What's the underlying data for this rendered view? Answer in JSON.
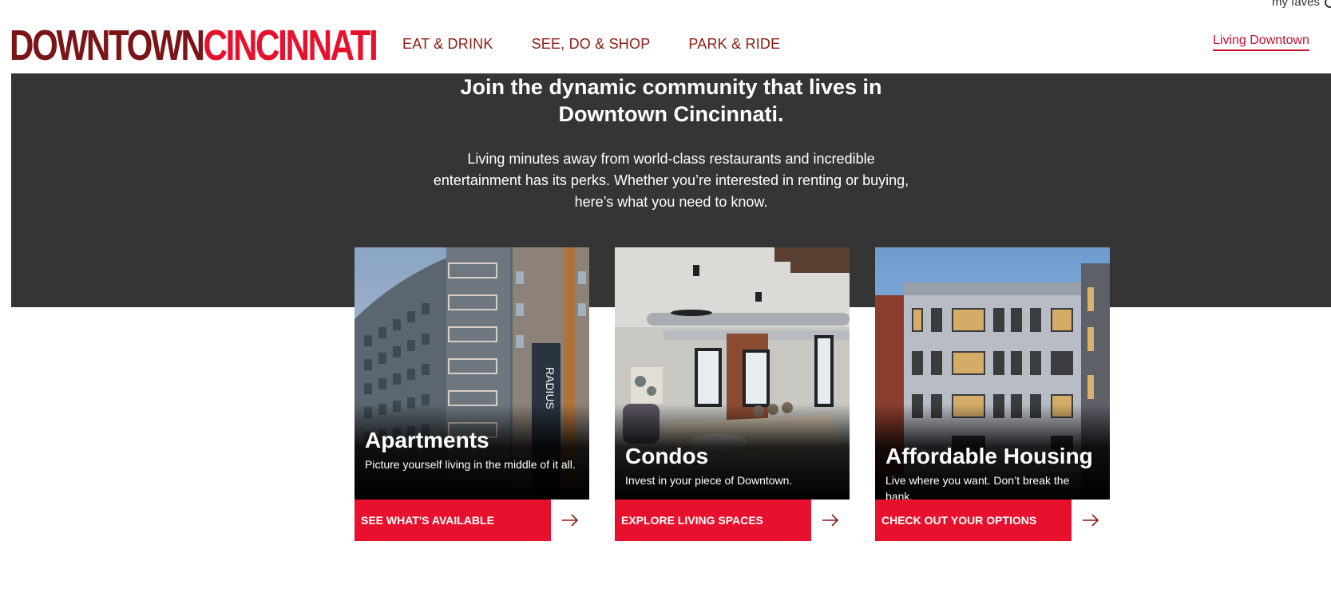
{
  "header": {
    "logo_part1": "DOWNTOWN",
    "logo_part2": "CINCINNATI",
    "my_faves": "my faves",
    "nav": [
      "EAT & DRINK",
      "SEE, DO & SHOP",
      "PARK & RIDE"
    ],
    "living_link": "Living Downtown"
  },
  "hero": {
    "heading": "Join the dynamic community that lives in Downtown Cincinnati.",
    "body": "Living minutes away from world-class restaurants and incredible entertainment has its perks. Whether you’re interested in renting or buying, here’s what you need to know."
  },
  "cards": [
    {
      "title": "Apartments",
      "subtitle": "Picture yourself living in the middle of it all.",
      "cta": "SEE WHAT'S AVAILABLE",
      "image_icon": "apartment-building-photo",
      "sign_text": "RADIUS"
    },
    {
      "title": "Condos",
      "subtitle": "Invest in your piece of Downtown.",
      "cta": "EXPLORE LIVING SPACES",
      "image_icon": "condo-interior-photo"
    },
    {
      "title": "Affordable Housing",
      "subtitle": "Live where you want. Don’t break the bank.",
      "cta": "CHECK OUT YOUR OPTIONS",
      "image_icon": "brick-building-photo"
    }
  ],
  "colors": {
    "brand_dark_red": "#7a1416",
    "brand_red": "#e8112d",
    "nav_text": "#8c1c13",
    "hero_bg": "#353535"
  }
}
